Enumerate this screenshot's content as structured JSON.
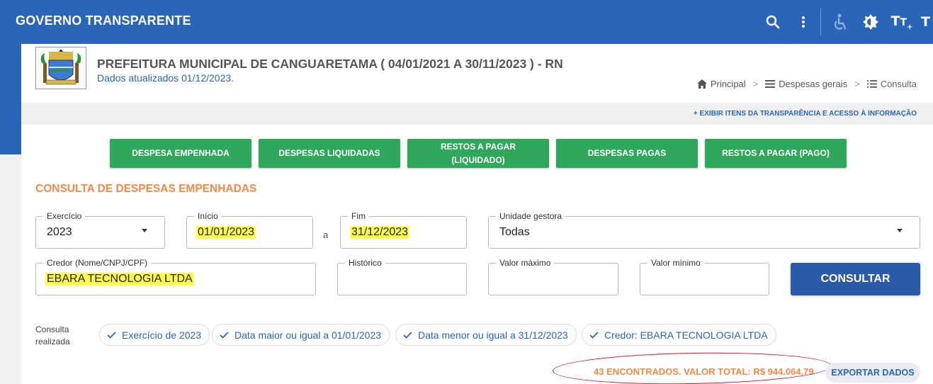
{
  "app": {
    "title": "GOVERNO TRANSPARENTE"
  },
  "toolbar": {
    "icons": [
      "search-icon",
      "more-vertical-icon",
      "accessibility-icon",
      "contrast-icon",
      "font-increase-icon",
      "font-decrease-icon"
    ],
    "font_label": "T"
  },
  "header": {
    "org_title": "PREFEITURA MUNICIPAL DE CANGUARETAMA ( 04/01/2021 A 30/11/2023 ) - RN",
    "updated": "Dados atualizados 01/12/2023."
  },
  "breadcrumb": {
    "home": "Principal",
    "section": "Despesas gerais",
    "current": "Consulta",
    "separator": ">"
  },
  "transparency_link": "+ EXIBIR ITENS DA TRANSPARÊNCIA E ACESSO À INFORMAÇÃO",
  "tabs": [
    {
      "label": "DESPESA EMPENHADA"
    },
    {
      "label": "DESPESAS LIQUIDADAS"
    },
    {
      "label": "RESTOS A PAGAR (LIQUIDADO)"
    },
    {
      "label": "DESPESAS PAGAS"
    },
    {
      "label": "RESTOS A PAGAR (PAGO)"
    }
  ],
  "section_title": "CONSULTA DE DESPESAS EMPENHADAS",
  "form": {
    "exercicio": {
      "label": "Exercício",
      "value": "2023"
    },
    "inicio": {
      "label": "Início",
      "value": "01/01/2023"
    },
    "a": "a",
    "fim": {
      "label": "Fim",
      "value": "31/12/2023"
    },
    "unidade": {
      "label": "Unidade gestora",
      "value": "Todas"
    },
    "credor": {
      "label": "Credor (Nome/CNPJ/CPF)",
      "value": "EBARA TECNOLOGIA LTDA"
    },
    "historico": {
      "label": "Histórico",
      "value": ""
    },
    "valor_max": {
      "label": "Valor máximo",
      "value": ""
    },
    "valor_min": {
      "label": "Valor mínimo",
      "value": ""
    },
    "submit": "CONSULTAR"
  },
  "consulta": {
    "label_line1": "Consulta",
    "label_line2": "realizada",
    "chips": [
      "Exercício de 2023",
      "Data maior ou igual a 01/01/2023",
      "Data menor ou igual a 31/12/2023",
      "Credor: EBARA TECNOLOGIA LTDA"
    ]
  },
  "results": {
    "summary": "43 ENCONTRADOS. VALOR TOTAL: R$ 944.064,79",
    "export": "EXPORTAR DADOS"
  },
  "colors": {
    "primary": "#2b65b8",
    "tab_green": "#2fa85c",
    "accent_orange": "#f08a47",
    "highlight": "#ffff4d",
    "annotation_red": "#dd1122"
  }
}
